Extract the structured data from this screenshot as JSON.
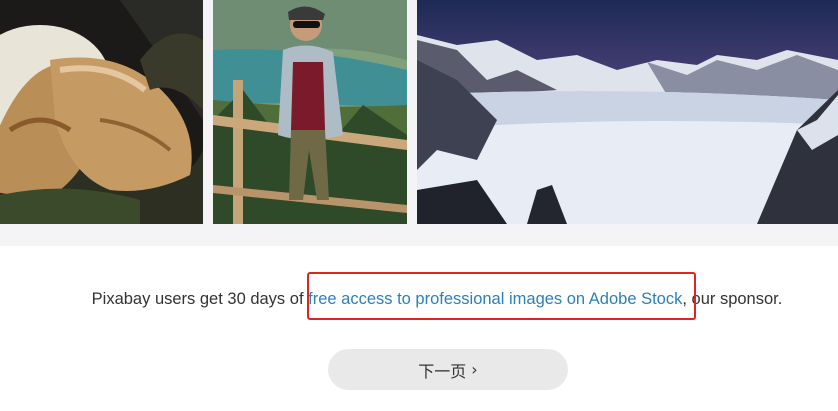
{
  "gallery": {
    "images": [
      {
        "subject": "zongzi rice dumplings"
      },
      {
        "subject": "young man in sunglasses and cap by mountain lake"
      },
      {
        "subject": "snowy mountain crater lake under purple sky"
      }
    ]
  },
  "sponsor": {
    "prefix": "Pixabay users get 30 days of ",
    "link_text": "free access to professional images on Adobe Stock",
    "suffix": ", our sponsor."
  },
  "pagination": {
    "next_label": "下一页",
    "next_icon": "›"
  },
  "colors": {
    "link": "#2b80b9",
    "highlight": "#e0231e",
    "button_bg": "#e9e9e9",
    "strip_bg": "#f4f4f6"
  }
}
